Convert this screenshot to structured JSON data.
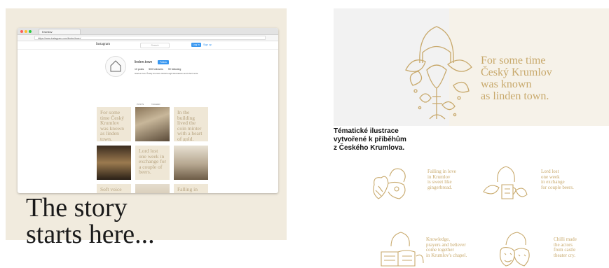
{
  "browser": {
    "tab_title": "Krumlov",
    "url": "https://www.instagram.com/linden/town/"
  },
  "instagram": {
    "logo": "Instagram",
    "search_placeholder": "Search",
    "login_label": "Log In",
    "signup_label": "Sign up",
    "username": "linden.town",
    "follow_label": "Follow",
    "stats": [
      "10 posts",
      "500 followers",
      "99 following"
    ],
    "bio": "Stories from Český Krumlov told through illustrations and short texts.",
    "tabs": [
      "POSTS",
      "TAGGED"
    ],
    "posts": [
      {
        "type": "text",
        "text": "For some time Český Krumlov was known as linden town."
      },
      {
        "type": "photo"
      },
      {
        "type": "text",
        "text": "In the building lived the coin minter with a heart of gold."
      },
      {
        "type": "photo"
      },
      {
        "type": "text",
        "text": "Lord lost one week in exchange for a couple of beers."
      },
      {
        "type": "photo"
      },
      {
        "type": "text",
        "text": "Soft voice whispers exciting stories from"
      },
      {
        "type": "photo"
      },
      {
        "type": "text",
        "text": "Falling in love in Krumlov is sweet like"
      }
    ]
  },
  "left": {
    "tagline_line1": "The story",
    "tagline_line2": "starts here..."
  },
  "right": {
    "hero_text": [
      "For some time",
      "Český Krumlov",
      "was known",
      "as linden town."
    ],
    "caption": [
      "Tématické ilustrace",
      "vytvořené k příběhům",
      "z Českého Krumlova."
    ],
    "thumbs": [
      {
        "text": [
          "Falling in love",
          "in Krumlov",
          "is sweet like",
          "gingerbread."
        ]
      },
      {
        "text": [
          "Lord lost",
          "one week",
          "in exchange",
          "for couple beers."
        ]
      },
      {
        "text": [
          "Knowledge,",
          "prayers and believer",
          "come together",
          "in Krumlov's chapel."
        ]
      },
      {
        "text": [
          "Chilli made",
          "the actors",
          "from castle",
          "theater cry."
        ]
      }
    ]
  },
  "colors": {
    "gold": "#c8a96c",
    "beige": "#f1ebde",
    "instagram_blue": "#3897f0"
  }
}
